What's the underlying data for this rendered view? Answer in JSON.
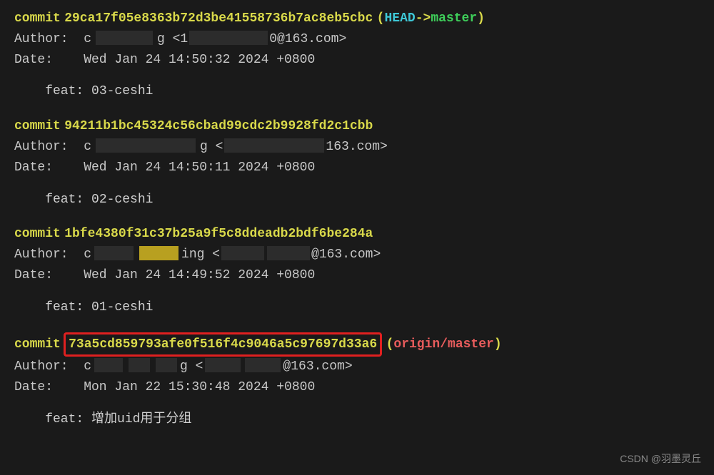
{
  "commits": [
    {
      "hash": "29ca17f05e8363b72d3be41558736b7ac8eb5cbc",
      "ref_head": "HEAD",
      "ref_arrow": " -> ",
      "ref_branch": "master",
      "author_label": "Author:",
      "author_prefix": "c",
      "author_suffix": "g <1",
      "author_email_suffix": "0@163.com>",
      "date_label": "Date:",
      "date_value": "Wed Jan 24 14:50:32 2024 +0800",
      "message": "feat: 03-ceshi"
    },
    {
      "hash": "94211b1bc45324c56cbad99cdc2b9928fd2c1cbb",
      "author_label": "Author:",
      "author_prefix": "c",
      "author_suffix": "g <",
      "author_email_suffix": "163.com>",
      "date_label": "Date:",
      "date_value": "Wed Jan 24 14:50:11 2024 +0800",
      "message": "feat: 02-ceshi"
    },
    {
      "hash": "1bfe4380f31c37b25a9f5c8ddeadb2bdf6be284a",
      "author_label": "Author:",
      "author_prefix": "c",
      "author_suffix": "ing <",
      "author_email_suffix": "@163.com>",
      "date_label": "Date:",
      "date_value": "Wed Jan 24 14:49:52 2024 +0800",
      "message": "feat: 01-ceshi"
    },
    {
      "hash": "73a5cd859793afe0f516f4c9046a5c97697d33a6",
      "ref_remote": "origin/master",
      "author_label": "Author:",
      "author_prefix": "c",
      "author_suffix": "g <",
      "author_email_suffix": "@163.com>",
      "date_label": "Date:",
      "date_value": "Mon Jan 22 15:30:48 2024 +0800",
      "message": "feat: 增加uid用于分组"
    }
  ],
  "labels": {
    "commit": "commit",
    "paren_open": " (",
    "paren_close": ")"
  },
  "watermark": "CSDN @羽墨灵丘"
}
